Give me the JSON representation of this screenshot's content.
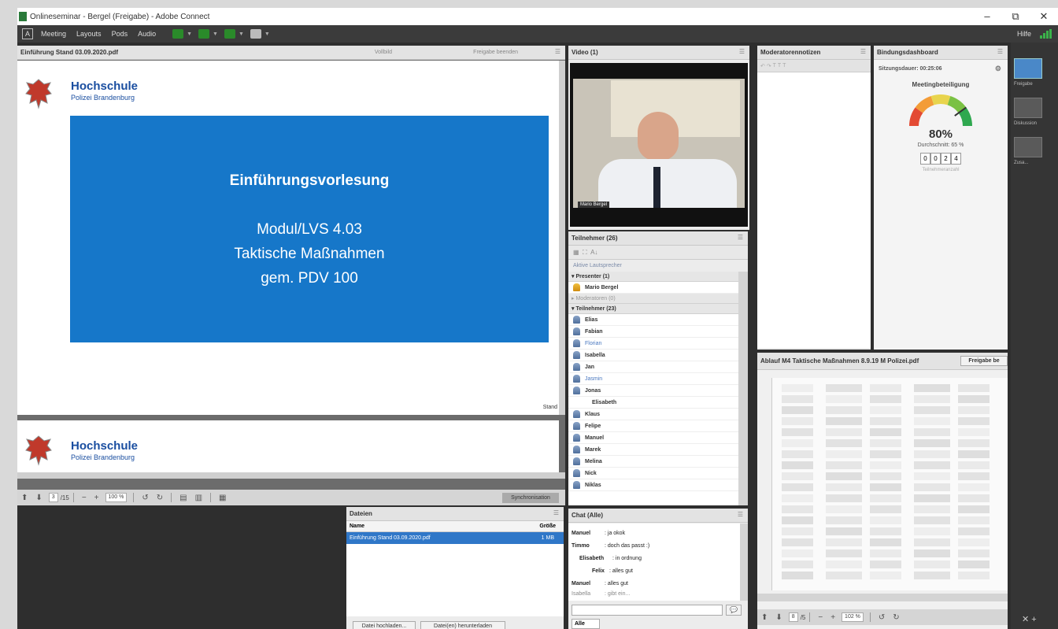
{
  "window": {
    "title": "Onlineseminar - Bergel (Freigabe) - Adobe Connect",
    "controls": [
      "–",
      "⧉",
      "✕"
    ]
  },
  "menubar": {
    "logo": "A",
    "items": [
      "Meeting",
      "Layouts",
      "Pods",
      "Audio"
    ],
    "help": "Hilfe"
  },
  "share_pod": {
    "title": "Einführung Stand 03.09.2020.pdf",
    "header_buttons": [
      "Vollbild",
      "Freigabe beenden"
    ],
    "slide": {
      "org_name": "Hochschule",
      "org_sub": "Polizei Brandenburg",
      "heading": "Einführungsvorlesung",
      "line1": "Modul/LVS 4.03",
      "line2": "Taktische Maßnahmen",
      "line3": "gem. PDV 100",
      "corner_text": "Stand"
    },
    "next_slide": {
      "org_name": "Hochschule",
      "org_sub": "Polizei Brandenburg"
    },
    "toolbar": {
      "page": "3",
      "page_total": "/15",
      "zoom": "100 %",
      "sync_button": "Synchronisation"
    }
  },
  "video_pod": {
    "title": "Video (1)",
    "name_tag": "Mario Bergel"
  },
  "participants_pod": {
    "title": "Teilnehmer (26)",
    "active_speaker": "Aktive Lautsprecher",
    "sections": {
      "presenters": "Presenter (1)",
      "hosts": "Moderatoren (0)",
      "participants": "Teilnehmer (23)"
    },
    "presenter_name": "Mario Bergel",
    "names": [
      "Elias",
      "Fabian",
      "Florian",
      "Isabella",
      "Jan",
      "Jasmin",
      "Jonas",
      "Elisabeth",
      "Klaus",
      "Felipe",
      "Manuel",
      "Marek",
      "Melina",
      "Nick",
      "Niklas"
    ]
  },
  "files_pod": {
    "title": "Dateien",
    "col_name": "Name",
    "col_size": "Größe",
    "file_name": "Einführung Stand 03.09.2020.pdf",
    "file_size": "1 MB",
    "upload_button": "Datei hochladen...",
    "download_button": "Datei(en) herunterladen"
  },
  "chat_pod": {
    "title": "Chat (Alle)",
    "messages": [
      {
        "from": "Manuel",
        "text": ": ja okok"
      },
      {
        "from": "Timmo",
        "text": ": doch das passt :)"
      },
      {
        "from": "Elisabeth",
        "text": ": in ordnung"
      },
      {
        "from": "Felix",
        "text": ": alles gut"
      },
      {
        "from": "Manuel",
        "text": ": alles gut"
      },
      {
        "from": "Isabella",
        "text": ": gibt ein..."
      }
    ],
    "tab": "Alle"
  },
  "moderator_pod": {
    "title": "Moderatorennotizen"
  },
  "dashboard_pod": {
    "title": "Bindungsdashboard",
    "duration_label": "Sitzungsdauer: 00:25:06",
    "engagement_label": "Meetingbeteiligung",
    "engagement_value": 80,
    "engagement_text": "80%",
    "average_text": "Durchschnitt: 65 %",
    "digits": [
      "0",
      "0",
      "2",
      "4"
    ],
    "participants_caption": "Teilnehmeranzahl"
  },
  "pdf_pod": {
    "title": "Ablauf M4 Taktische Maßnahmen 8.9.19 M Polizei.pdf",
    "share_button": "Freigabe be",
    "page": "8",
    "page_total": "/5",
    "zoom": "102 %"
  },
  "right_bar": {
    "items": [
      "Freigabe",
      "Diskussion",
      "Zusa..."
    ]
  },
  "colors": {
    "slide_blue": "#1677c9",
    "brand_blue": "#1a4ea0",
    "selection": "#2f77c8"
  }
}
